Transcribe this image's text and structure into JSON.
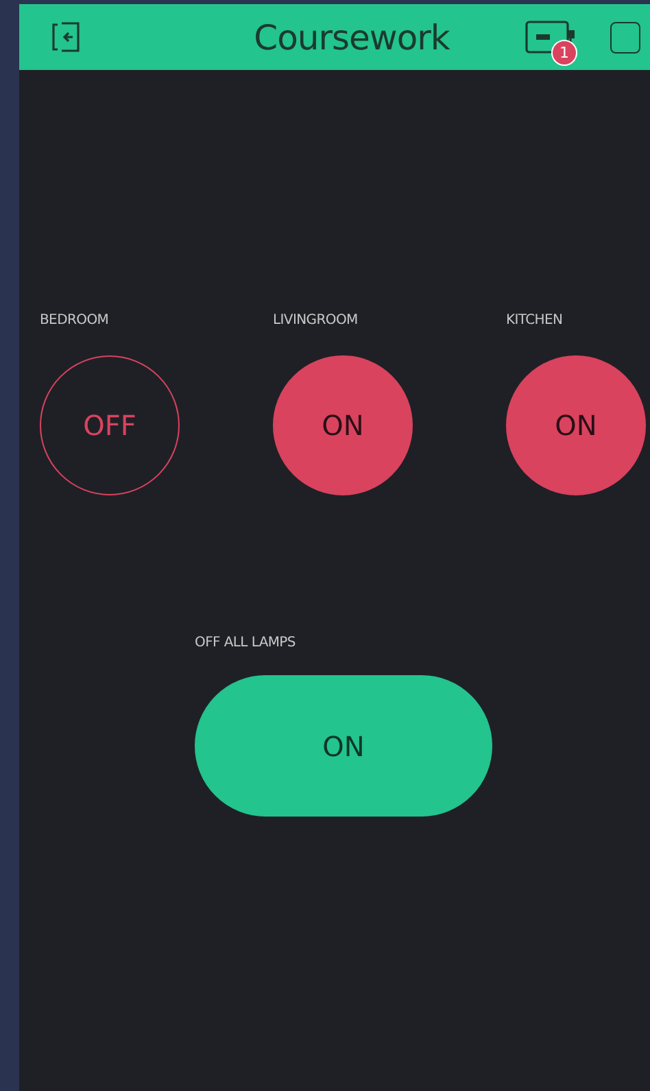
{
  "header": {
    "title": "Coursework",
    "device_badge": "1"
  },
  "buttons": [
    {
      "kind": "round",
      "label": "BEDROOM",
      "text": "OFF",
      "on": false,
      "color": "#d9435e"
    },
    {
      "kind": "round",
      "label": "LIVINGROOM",
      "text": "ON",
      "on": true,
      "color": "#d9435e"
    },
    {
      "kind": "round",
      "label": "KITCHEN",
      "text": "ON",
      "on": true,
      "color": "#d9435e"
    },
    {
      "kind": "pill",
      "label": "OFF ALL LAMPS",
      "text": "ON",
      "on": true,
      "color": "#23c48e"
    }
  ]
}
